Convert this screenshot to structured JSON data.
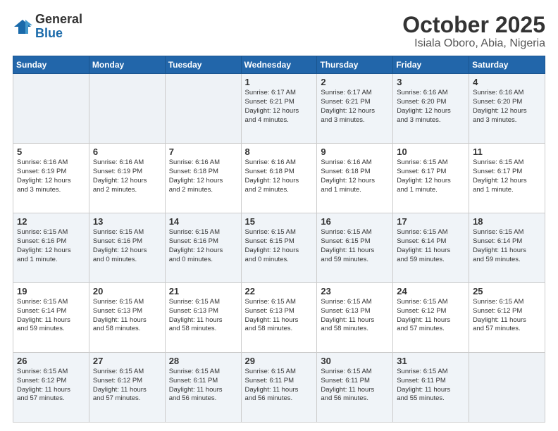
{
  "header": {
    "logo_general": "General",
    "logo_blue": "Blue",
    "title": "October 2025",
    "subtitle": "Isiala Oboro, Abia, Nigeria"
  },
  "weekdays": [
    "Sunday",
    "Monday",
    "Tuesday",
    "Wednesday",
    "Thursday",
    "Friday",
    "Saturday"
  ],
  "weeks": [
    [
      {
        "day": "",
        "info": ""
      },
      {
        "day": "",
        "info": ""
      },
      {
        "day": "",
        "info": ""
      },
      {
        "day": "1",
        "info": "Sunrise: 6:17 AM\nSunset: 6:21 PM\nDaylight: 12 hours\nand 4 minutes."
      },
      {
        "day": "2",
        "info": "Sunrise: 6:17 AM\nSunset: 6:21 PM\nDaylight: 12 hours\nand 3 minutes."
      },
      {
        "day": "3",
        "info": "Sunrise: 6:16 AM\nSunset: 6:20 PM\nDaylight: 12 hours\nand 3 minutes."
      },
      {
        "day": "4",
        "info": "Sunrise: 6:16 AM\nSunset: 6:20 PM\nDaylight: 12 hours\nand 3 minutes."
      }
    ],
    [
      {
        "day": "5",
        "info": "Sunrise: 6:16 AM\nSunset: 6:19 PM\nDaylight: 12 hours\nand 3 minutes."
      },
      {
        "day": "6",
        "info": "Sunrise: 6:16 AM\nSunset: 6:19 PM\nDaylight: 12 hours\nand 2 minutes."
      },
      {
        "day": "7",
        "info": "Sunrise: 6:16 AM\nSunset: 6:18 PM\nDaylight: 12 hours\nand 2 minutes."
      },
      {
        "day": "8",
        "info": "Sunrise: 6:16 AM\nSunset: 6:18 PM\nDaylight: 12 hours\nand 2 minutes."
      },
      {
        "day": "9",
        "info": "Sunrise: 6:16 AM\nSunset: 6:18 PM\nDaylight: 12 hours\nand 1 minute."
      },
      {
        "day": "10",
        "info": "Sunrise: 6:15 AM\nSunset: 6:17 PM\nDaylight: 12 hours\nand 1 minute."
      },
      {
        "day": "11",
        "info": "Sunrise: 6:15 AM\nSunset: 6:17 PM\nDaylight: 12 hours\nand 1 minute."
      }
    ],
    [
      {
        "day": "12",
        "info": "Sunrise: 6:15 AM\nSunset: 6:16 PM\nDaylight: 12 hours\nand 1 minute."
      },
      {
        "day": "13",
        "info": "Sunrise: 6:15 AM\nSunset: 6:16 PM\nDaylight: 12 hours\nand 0 minutes."
      },
      {
        "day": "14",
        "info": "Sunrise: 6:15 AM\nSunset: 6:16 PM\nDaylight: 12 hours\nand 0 minutes."
      },
      {
        "day": "15",
        "info": "Sunrise: 6:15 AM\nSunset: 6:15 PM\nDaylight: 12 hours\nand 0 minutes."
      },
      {
        "day": "16",
        "info": "Sunrise: 6:15 AM\nSunset: 6:15 PM\nDaylight: 11 hours\nand 59 minutes."
      },
      {
        "day": "17",
        "info": "Sunrise: 6:15 AM\nSunset: 6:14 PM\nDaylight: 11 hours\nand 59 minutes."
      },
      {
        "day": "18",
        "info": "Sunrise: 6:15 AM\nSunset: 6:14 PM\nDaylight: 11 hours\nand 59 minutes."
      }
    ],
    [
      {
        "day": "19",
        "info": "Sunrise: 6:15 AM\nSunset: 6:14 PM\nDaylight: 11 hours\nand 59 minutes."
      },
      {
        "day": "20",
        "info": "Sunrise: 6:15 AM\nSunset: 6:13 PM\nDaylight: 11 hours\nand 58 minutes."
      },
      {
        "day": "21",
        "info": "Sunrise: 6:15 AM\nSunset: 6:13 PM\nDaylight: 11 hours\nand 58 minutes."
      },
      {
        "day": "22",
        "info": "Sunrise: 6:15 AM\nSunset: 6:13 PM\nDaylight: 11 hours\nand 58 minutes."
      },
      {
        "day": "23",
        "info": "Sunrise: 6:15 AM\nSunset: 6:13 PM\nDaylight: 11 hours\nand 58 minutes."
      },
      {
        "day": "24",
        "info": "Sunrise: 6:15 AM\nSunset: 6:12 PM\nDaylight: 11 hours\nand 57 minutes."
      },
      {
        "day": "25",
        "info": "Sunrise: 6:15 AM\nSunset: 6:12 PM\nDaylight: 11 hours\nand 57 minutes."
      }
    ],
    [
      {
        "day": "26",
        "info": "Sunrise: 6:15 AM\nSunset: 6:12 PM\nDaylight: 11 hours\nand 57 minutes."
      },
      {
        "day": "27",
        "info": "Sunrise: 6:15 AM\nSunset: 6:12 PM\nDaylight: 11 hours\nand 57 minutes."
      },
      {
        "day": "28",
        "info": "Sunrise: 6:15 AM\nSunset: 6:11 PM\nDaylight: 11 hours\nand 56 minutes."
      },
      {
        "day": "29",
        "info": "Sunrise: 6:15 AM\nSunset: 6:11 PM\nDaylight: 11 hours\nand 56 minutes."
      },
      {
        "day": "30",
        "info": "Sunrise: 6:15 AM\nSunset: 6:11 PM\nDaylight: 11 hours\nand 56 minutes."
      },
      {
        "day": "31",
        "info": "Sunrise: 6:15 AM\nSunset: 6:11 PM\nDaylight: 11 hours\nand 55 minutes."
      },
      {
        "day": "",
        "info": ""
      }
    ]
  ]
}
